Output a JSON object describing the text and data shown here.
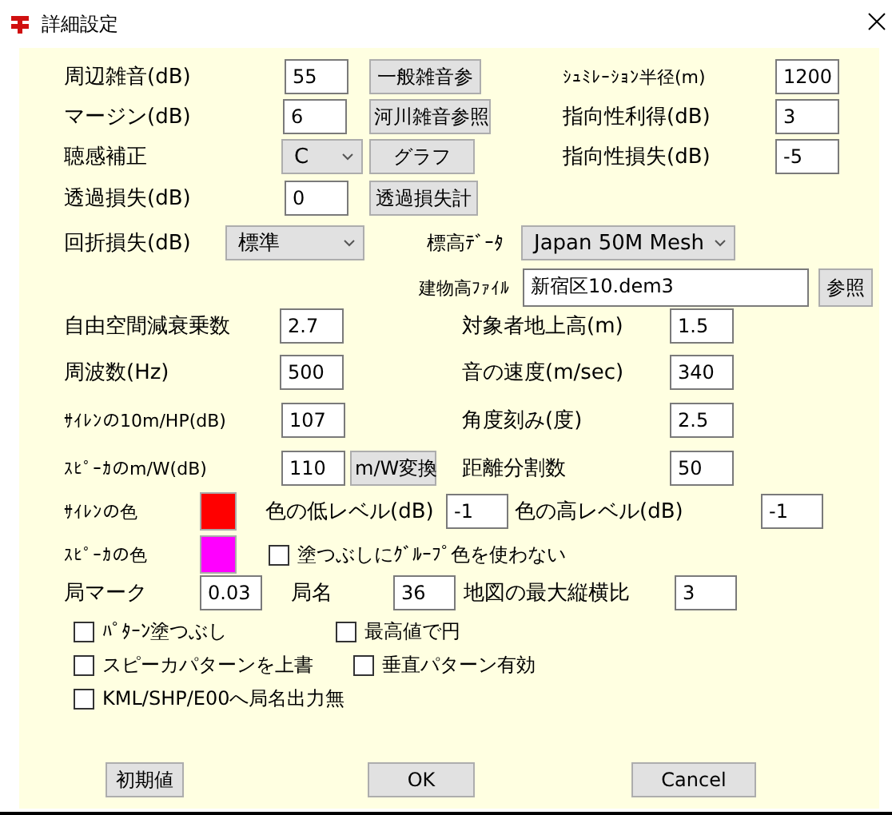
{
  "window": {
    "title": "詳細設定"
  },
  "noise_rows": [
    {
      "label": "周辺雑音(dB)",
      "kind": "text",
      "value": "55",
      "button": "一般雑音参"
    },
    {
      "label": "マージン(dB)",
      "kind": "text",
      "value": "6",
      "button": "河川雑音参照"
    },
    {
      "label": "聴感補正",
      "kind": "select",
      "value": "C",
      "button": "グラフ"
    },
    {
      "label": "透過損失(dB)",
      "kind": "text",
      "value": "0",
      "button": "透過損失計"
    }
  ],
  "radius_rows": [
    {
      "label": "ｼｭﾐﾚｰｼｮﾝ半径(m)",
      "value": "1200"
    },
    {
      "label": "指向性利得(dB)",
      "value": "3"
    },
    {
      "label": "指向性損失(dB)",
      "value": "-5"
    }
  ],
  "diffraction": {
    "label": "回折損失(dB)",
    "value": "標準"
  },
  "elevation_data": {
    "label": "標高ﾃﾞｰﾀ",
    "value": "Japan 50M Mesh"
  },
  "building_file": {
    "label": "建物高ﾌｧｲﾙ",
    "value": "新宿区10.dem3",
    "button": "参照"
  },
  "params_left": [
    {
      "label": "自由空間減衰乗数",
      "value": "2.7"
    },
    {
      "label": "周波数(Hz)",
      "value": "500"
    },
    {
      "label": "ｻｲﾚﾝの10m/HP(dB)",
      "value": "107"
    },
    {
      "label": "ｽﾋﾟｰｶのm/W(dB)",
      "value": "110",
      "button": "m/W変換"
    }
  ],
  "params_right": [
    {
      "label": "対象者地上高(m)",
      "value": "1.5"
    },
    {
      "label": "音の速度(m/sec)",
      "value": "340"
    },
    {
      "label": "角度刻み(度)",
      "value": "2.5"
    },
    {
      "label": "距離分割数",
      "value": "50"
    }
  ],
  "colors": [
    {
      "label": "ｻｲﾚﾝの色",
      "color": "#ff0000"
    },
    {
      "label": "ｽﾋﾟｰｶの色",
      "color": "#ff00ff"
    }
  ],
  "low_level": {
    "label": "色の低レベル(dB)",
    "value": "-1"
  },
  "high_level": {
    "label": "色の高レベル(dB)",
    "value": "-1"
  },
  "no_group_color": {
    "label": "塗つぶしにｸﾞﾙｰﾌﾟ色を使わない",
    "checked": false
  },
  "station_mark": {
    "label": "局マーク",
    "value": "0.03"
  },
  "station_name": {
    "label": "局名",
    "value": "36"
  },
  "max_aspect": {
    "label": "地図の最大縦横比",
    "value": "3"
  },
  "options": [
    {
      "label": "ﾊﾟﾀｰﾝ塗つぶし",
      "checked": false
    },
    {
      "label": "最高値で円",
      "checked": false
    },
    {
      "label": "スピーカパターンを上書",
      "checked": false
    },
    {
      "label": "垂直パターン有効",
      "checked": false
    },
    {
      "label": "KML/SHP/E00へ局名出力無",
      "checked": false
    }
  ],
  "buttons": [
    "初期値",
    "OK",
    "Cancel"
  ]
}
